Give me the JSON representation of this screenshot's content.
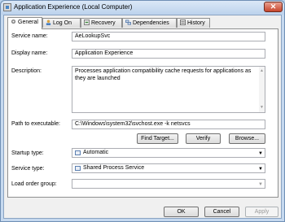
{
  "window": {
    "title": "Application Experience (Local Computer)",
    "close_glyph": "✕"
  },
  "tabs": [
    {
      "label": "General",
      "icon": "gear-icon",
      "active": true
    },
    {
      "label": "Log On",
      "icon": "user-icon"
    },
    {
      "label": "Recovery",
      "icon": "recovery-icon"
    },
    {
      "label": "Dependencies",
      "icon": "dependencies-icon"
    },
    {
      "label": "History",
      "icon": "history-icon"
    }
  ],
  "general": {
    "service_name_label": "Service name:",
    "service_name": "AeLookupSvc",
    "display_name_label": "Display name:",
    "display_name": "Application Experience",
    "description_label": "Description:",
    "description": "Processes application compatibility cache requests for applications as they are launched",
    "path_label": "Path to executable:",
    "path": "C:\\Windows\\system32\\svchost.exe -k netsvcs",
    "find_target_label": "Find Target...",
    "verify_label": "Verify",
    "browse_label": "Browse...",
    "startup_type_label": "Startup type:",
    "startup_type": "Automatic",
    "service_type_label": "Service type:",
    "service_type": "Shared Process Service",
    "load_order_label": "Load order group:",
    "load_order": ""
  },
  "footer": {
    "ok_label": "OK",
    "cancel_label": "Cancel",
    "apply_label": "Apply"
  }
}
